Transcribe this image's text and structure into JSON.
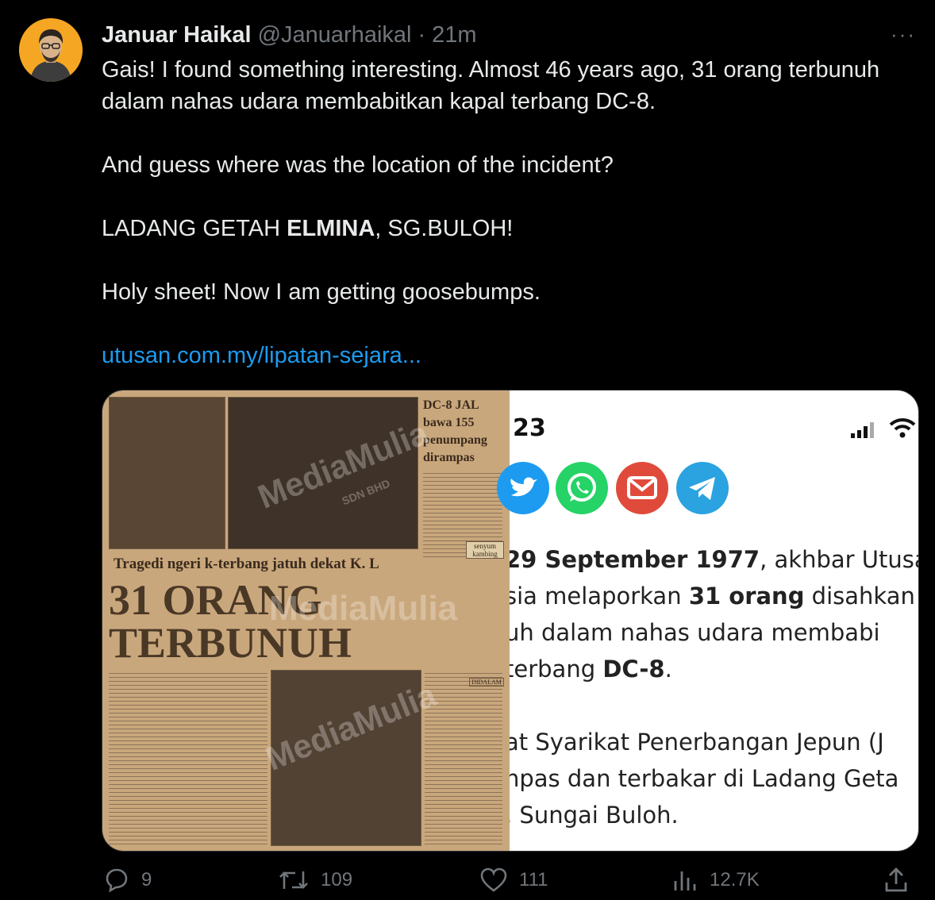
{
  "tweet": {
    "author_name": "Januar Haikal",
    "handle": "@Januarhaikal",
    "separator": "·",
    "time": "21m",
    "more_label": "···",
    "lines": [
      "Gais! I found something interesting. Almost 46 years ago, 31 orang terbunuh dalam nahas udara membabitkan kapal terbang DC-8.",
      "And guess where was the location of the incident?"
    ],
    "location_prefix": "LADANG GETAH ",
    "location_bold": "ELMINA",
    "location_suffix": ", SG.BULOH!",
    "reaction": "Holy sheet! Now I am getting goosebumps.",
    "link_text": "utusan.com.my/lipatan-sejara..."
  },
  "newspaper": {
    "sidebar_headline": "DC-8 JAL bawa 155 penumpang dirampas",
    "strap": "Tragedi ngeri k-terbang jatuh dekat K. L",
    "headline_1": "31 ORANG",
    "headline_2": "TERBUNUH",
    "box_1": "senyum kambing",
    "box_2": "DIDALAM",
    "watermark": "MediaMulia",
    "watermark_sub": "SDN BHD"
  },
  "phone": {
    "time_fragment": "23",
    "share_icons": [
      "twitter-icon",
      "whatsapp-icon",
      "email-icon",
      "telegram-icon"
    ],
    "share_colors": [
      "#1d9bf0",
      "#25d366",
      "#e04a3a",
      "#2aa3e0"
    ],
    "article": {
      "l1_bold": "29 September 1977",
      "l1_rest": ", akhbar Utusan",
      "l2_pre": "sia melaporkan ",
      "l2_bold": "31 orang",
      "l2_rest": " disahkan",
      "l3": "uh dalam nahas udara membabi",
      "l4_pre": "terbang ",
      "l4_bold": "DC-8",
      "l4_rest": ".",
      "l5": "at Syarikat Penerbangan Jepun (J",
      "l6": "npas dan terbakar di Ladang Geta",
      "l7": ", Sungai Buloh."
    }
  },
  "actions": {
    "replies": "9",
    "retweets": "109",
    "likes": "111",
    "views": "12.7K"
  }
}
